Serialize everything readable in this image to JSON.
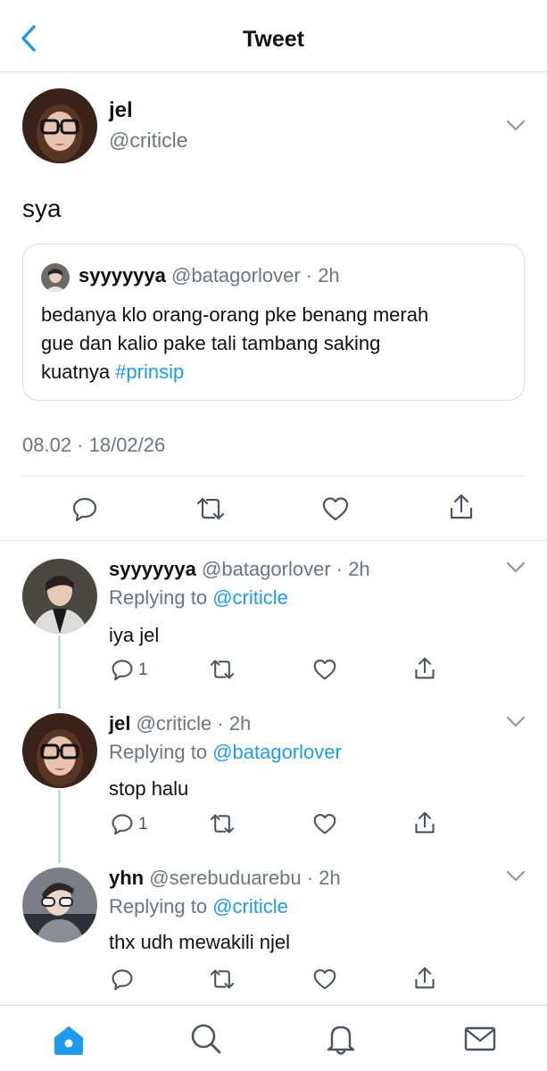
{
  "header": {
    "title": "Tweet"
  },
  "main_tweet": {
    "name": "jel",
    "handle": "@criticle",
    "text": "sya",
    "timestamp": "08.02 · 18/02/26",
    "quote": {
      "name": "syyyyyya",
      "handle_time": "@batagorlover · 2h",
      "lines": [
        "bedanya klo orang-orang pke benang merah",
        "gue dan kalio pake tali tambang saking"
      ],
      "last_line_text": "kuatnya ",
      "hashtag": "#prinsip"
    }
  },
  "replies": [
    {
      "name": "syyyyyya",
      "meta": "@batagorlover · 2h",
      "replying_prefix": "Replying to ",
      "replying_to": "@criticle",
      "text": "iya jel",
      "reply_count": "1"
    },
    {
      "name": "jel",
      "meta": "@criticle · 2h",
      "replying_prefix": "Replying to ",
      "replying_to": "@batagorlover",
      "text": "stop halu",
      "reply_count": "1"
    },
    {
      "name": "yhn",
      "meta": "@serebuduarebu · 2h",
      "replying_prefix": "Replying to ",
      "replying_to": "@criticle",
      "text": "thx udh mewakili njel",
      "reply_count": ""
    }
  ],
  "colors": {
    "accent": "#1d9bf0",
    "secondary_text": "#6b7680",
    "divider": "#e1e5e8"
  },
  "icons": [
    "back-chevron-icon",
    "chevron-down-icon",
    "reply-icon",
    "retweet-icon",
    "like-icon",
    "share-icon",
    "home-icon",
    "search-icon",
    "bell-icon",
    "mail-icon"
  ]
}
